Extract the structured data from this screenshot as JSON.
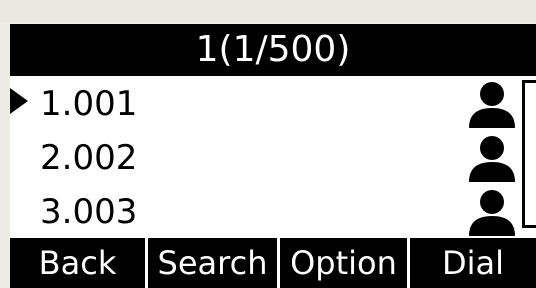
{
  "header": {
    "title": "1(1/500)"
  },
  "contacts": [
    {
      "label": "1.001",
      "selected": true,
      "icon": "person-icon"
    },
    {
      "label": "2.002",
      "selected": false,
      "icon": "person-icon"
    },
    {
      "label": "3.003",
      "selected": false,
      "icon": "person-icon"
    }
  ],
  "softkeys": [
    "Back",
    "Search",
    "Option",
    "Dial"
  ],
  "colors": {
    "screen": "#ffffff",
    "bar": "#000000",
    "text": "#000000",
    "bar_text": "#ffffff",
    "frame": "#ecece4"
  }
}
